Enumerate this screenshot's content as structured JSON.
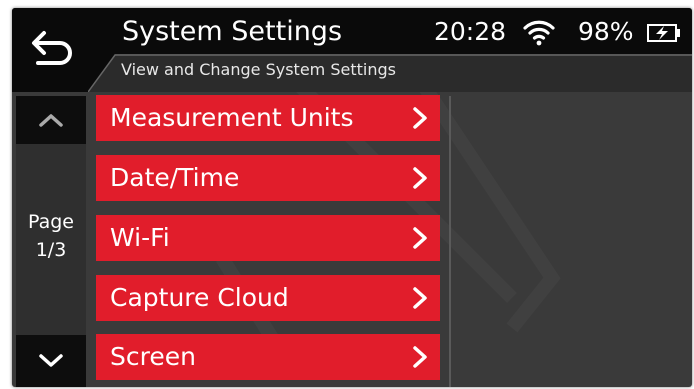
{
  "header": {
    "title": "System Settings",
    "subtitle": "View and Change System Settings",
    "time": "20:28",
    "battery_percent": "98%",
    "battery_charging": true,
    "wifi_connected": true
  },
  "pager": {
    "page_label": "Page",
    "page_position": "1/3",
    "up_icon": "chevron-up-icon",
    "down_icon": "chevron-down-icon"
  },
  "menu": {
    "items": [
      {
        "label": "Measurement Units"
      },
      {
        "label": "Date/Time"
      },
      {
        "label": "Wi-Fi"
      },
      {
        "label": "Capture Cloud"
      },
      {
        "label": "Screen"
      }
    ]
  },
  "colors": {
    "accent_red": "#e11d2b",
    "background": "#3a3a3a",
    "header": "#0a0a0a"
  }
}
